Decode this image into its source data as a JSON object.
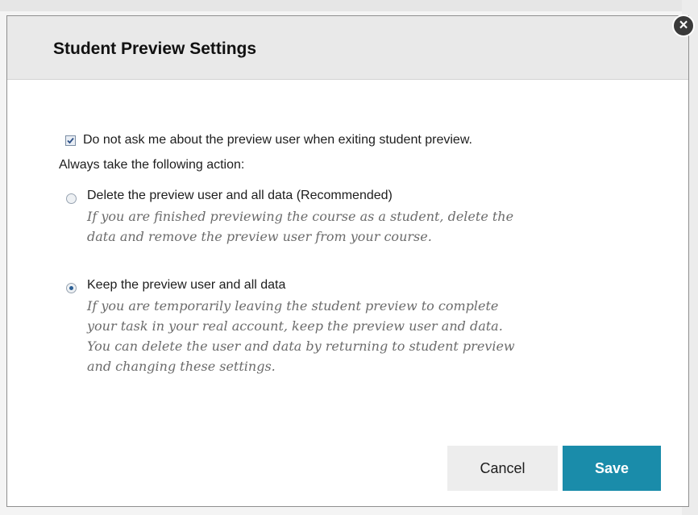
{
  "dialog": {
    "title": "Student Preview Settings",
    "close_label": "×"
  },
  "preference": {
    "do_not_ask_label": "Do not ask me about the preview user when exiting student preview.",
    "do_not_ask_checked": true,
    "action_prompt": "Always take the following action:"
  },
  "options": [
    {
      "label": "Delete the preview user and all data (Recommended)",
      "selected": false,
      "description_lines": [
        "If you are finished previewing the course as a student, delete the",
        "data and remove the preview user from your course."
      ]
    },
    {
      "label": "Keep the preview user and all data",
      "selected": true,
      "description_lines": [
        "If you are temporarily leaving the student preview to complete",
        "your task in your real account, keep the preview user and data.",
        "You can delete the user and data by returning to student preview",
        "and changing these settings."
      ]
    }
  ],
  "buttons": {
    "cancel_label": "Cancel",
    "save_label": "Save"
  },
  "colors": {
    "primary_button": "#1a8caa",
    "header_background": "#e9e9e9"
  }
}
